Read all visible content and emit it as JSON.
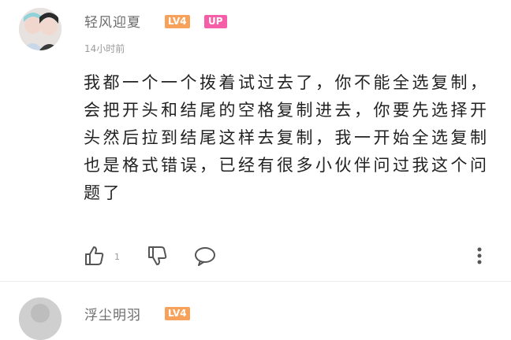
{
  "comment": {
    "username": "轻风迎夏",
    "level_badge": "LV4",
    "up_badge": "UP",
    "time": "14小时前",
    "text": "我都一个一个拨着试过去了，你不能全选复制，会把开头和结尾的空格复制进去，你要先选择开头然后拉到结尾这样去复制，我一开始全选复制也是格式错误，已经有很多小伙伴问过我这个问题了",
    "like_count": "1",
    "icons": {
      "like": "thumbs-up-icon",
      "dislike": "thumbs-down-icon",
      "reply": "chat-bubble-icon",
      "more": "more-vertical-icon"
    }
  },
  "next_comment": {
    "username": "浮尘明羽",
    "level_badge": "LV4"
  },
  "colors": {
    "level_badge": "#f8a15a",
    "up_badge": "#f65ea7",
    "username": "#6c6c6c",
    "time": "#9a9a9a"
  }
}
